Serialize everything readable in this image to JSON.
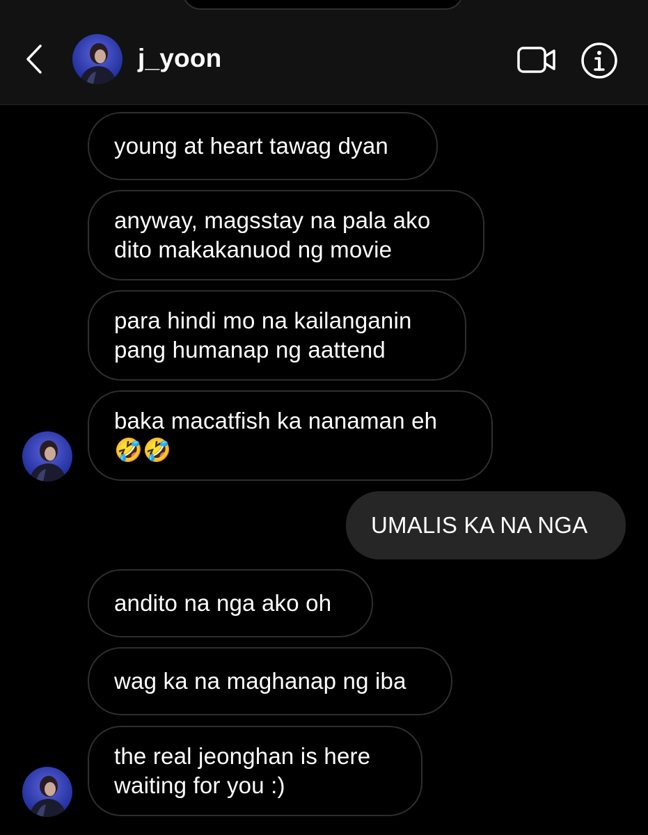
{
  "header": {
    "username": "j_yoon",
    "back_icon": "chevron-left-icon",
    "video_icon": "video-camera-icon",
    "info_icon": "info-icon"
  },
  "messages": [
    {
      "direction": "received",
      "text": "young at heart tawag dyan"
    },
    {
      "direction": "received",
      "text": "anyway, magsstay na pala ako\ndito makakanuod ng movie"
    },
    {
      "direction": "received",
      "text": "para hindi mo na kailanganin\npang humanap ng aattend"
    },
    {
      "direction": "received",
      "text": "baka macatfish ka nanaman eh\n🤣🤣"
    },
    {
      "direction": "sent",
      "text": "UMALIS KA NA NGA"
    },
    {
      "direction": "received",
      "text": "andito na nga ako oh"
    },
    {
      "direction": "received",
      "text": "wag ka na maghanap ng iba"
    },
    {
      "direction": "received",
      "text": "the real jeonghan is here\nwaiting for you :)"
    }
  ],
  "colors": {
    "background": "#000000",
    "header_background": "#121212",
    "received_border": "#2e2e2e",
    "sent_bubble": "#262626",
    "text": "#ffffff"
  }
}
